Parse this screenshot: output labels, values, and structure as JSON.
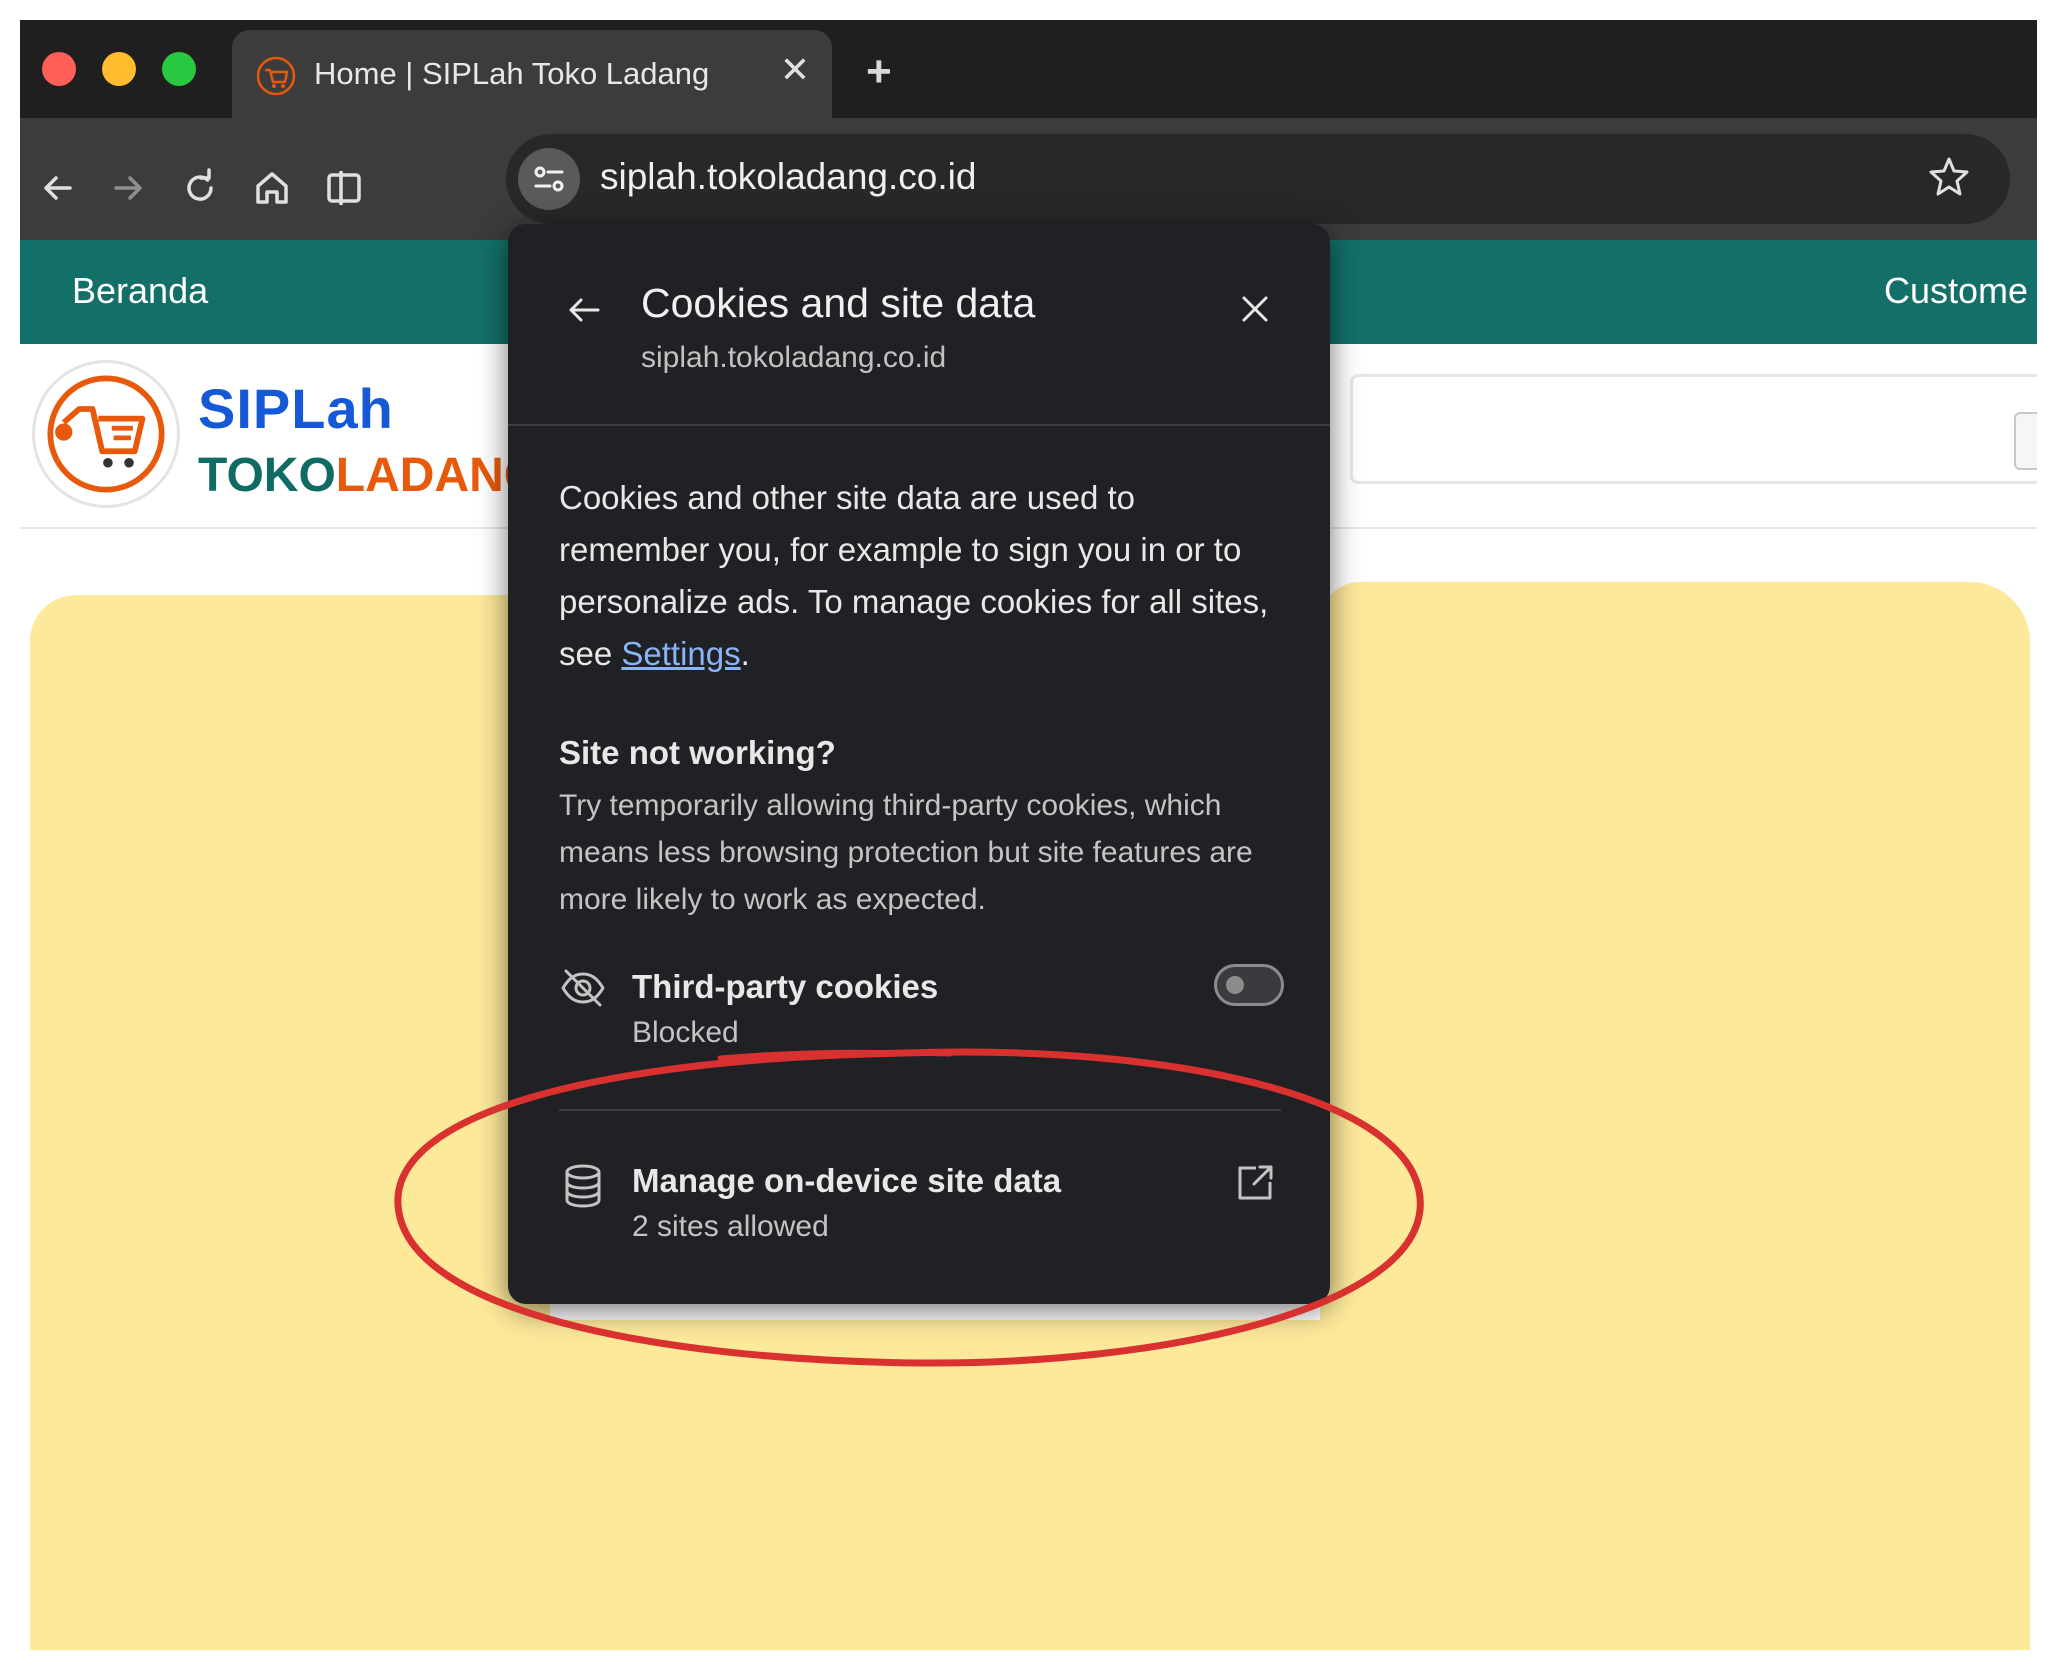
{
  "browser": {
    "tab": {
      "title": "Home | SIPLah Toko Ladang",
      "close_glyph": "✕"
    },
    "new_tab_glyph": "+",
    "address_bar": {
      "url": "siplah.tokoladang.co.id"
    },
    "icons": [
      "back-icon",
      "forward-icon",
      "reload-icon",
      "home-icon",
      "side-panel-icon",
      "site-info-icon",
      "bookmark-star-icon"
    ]
  },
  "page": {
    "nav": {
      "home_label": "Beranda",
      "customer_label": "Custome"
    },
    "logo": {
      "line1": "SIPLah",
      "line2_a": "TOKO",
      "line2_b": "LADANG"
    }
  },
  "popup": {
    "title": "Cookies and site data",
    "subtitle": "siplah.tokoladang.co.id",
    "body_text": "Cookies and other site data are used to remember you, for example to sign you in or to personalize ads. To manage cookies for all sites, see ",
    "settings_link": "Settings",
    "body_end": ".",
    "site_not_working": {
      "heading": "Site not working?",
      "text": "Try temporarily allowing third-party cookies, which means less browsing protection but site features are more likely to work as expected."
    },
    "third_party": {
      "title": "Third-party cookies",
      "status": "Blocked",
      "toggle_on": false
    },
    "manage": {
      "title": "Manage on-device site data",
      "status": "2 sites allowed"
    }
  },
  "colors": {
    "nav_teal": "#137068",
    "logo_blue": "#1559d6",
    "logo_orange": "#e8590c",
    "popup_bg": "#202124",
    "link_blue": "#8ab4f8",
    "annotation_red": "#d93030",
    "redaction_yellow": "#fde99a"
  }
}
